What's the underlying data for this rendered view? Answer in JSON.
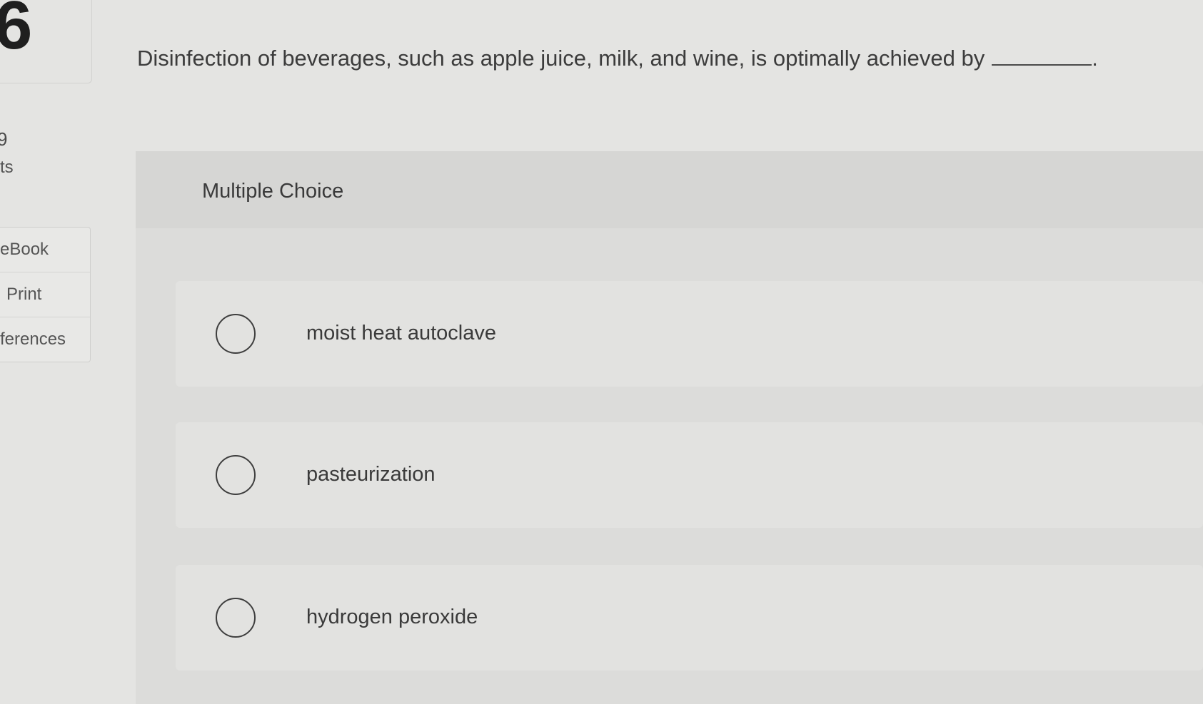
{
  "sidebar": {
    "question_number": "6",
    "points_value": "9",
    "points_label": "ts",
    "menu": [
      {
        "label": "eBook"
      },
      {
        "label": "Print"
      },
      {
        "label": "ferences"
      }
    ]
  },
  "question": {
    "text": "Disinfection of beverages, such as apple juice, milk, and wine, is optimally achieved by",
    "terminal": "."
  },
  "answer_panel": {
    "title": "Multiple Choice",
    "options": [
      {
        "label": "moist heat autoclave",
        "selected": false
      },
      {
        "label": "pasteurization",
        "selected": false
      },
      {
        "label": "hydrogen peroxide",
        "selected": false
      }
    ]
  },
  "colors": {
    "background": "#e4e4e2",
    "panel": "#dcdcda",
    "text": "#3a3a3a"
  },
  "icons": {
    "radio": "empty-circle-radio-icon"
  }
}
